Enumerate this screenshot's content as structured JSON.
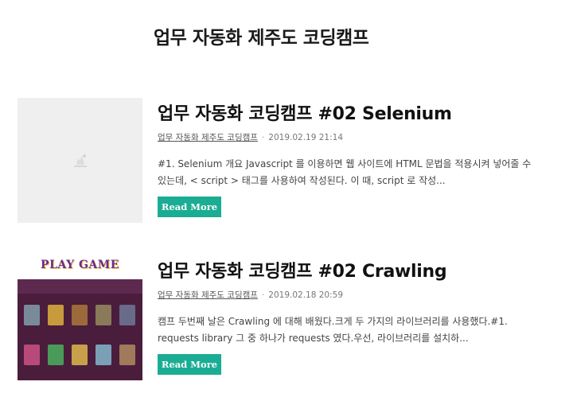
{
  "blog": {
    "title": "업무 자동화 제주도 코딩캠프"
  },
  "posts": [
    {
      "title": "업무 자동화 코딩캠프 #02 Selenium",
      "category": "업무 자동화 제주도 코딩캠프",
      "date": "2019.02.19 21:14",
      "excerpt": "#1. Selenium 개요 Javascript 를 이용하면 웹 사이트에 HTML 문법을 적용시켜 넣어줄 수 있는데, < script > 태그를 사용하여 작성된다. 이 때, script 로 작성...",
      "read_more": "Read More",
      "thumbnail": "placeholder-image-icon"
    },
    {
      "title": "업무 자동화 코딩캠프 #02 Crawling",
      "category": "업무 자동화 제주도 코딩캠프",
      "date": "2019.02.18 20:59",
      "excerpt": "캠프 두번째 날은 Crawling 에 대해 배웠다.크게 두 가지의 라이브러리를 사용했다.#1. requests library 그 중 하나가 requests 였다.우선, 라이브러리를 설치하...",
      "read_more": "Read More",
      "thumbnail": {
        "title": "PLAY GAME",
        "tiles": [
          {
            "color": "#7a8a9a"
          },
          {
            "color": "#c79a3b"
          },
          {
            "color": "#9c6a3a"
          },
          {
            "color": "#8a7a5a"
          },
          {
            "color": "#6a6a8a"
          },
          {
            "color": "#b84a7a"
          },
          {
            "color": "#4a9a5a"
          },
          {
            "color": "#c8a04a"
          },
          {
            "color": "#7aa0b8"
          },
          {
            "color": "#a07a5a"
          }
        ]
      }
    }
  ],
  "colors": {
    "accent": "#1aad94",
    "placeholder_bg": "#efefef"
  }
}
